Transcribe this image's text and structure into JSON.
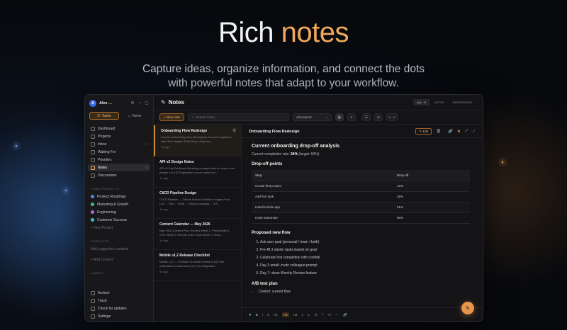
{
  "hero": {
    "title_main": "Rich",
    "title_accent": "notes",
    "subtitle_line1": "Capture ideas, organize information, and connect the dots",
    "subtitle_line2": "with powerful notes that adapt to your workflow."
  },
  "app": {
    "user_name": "Alex ...",
    "user_initial": "A",
    "tabs": [
      {
        "label": "Tasks",
        "active": true
      },
      {
        "label": "Home",
        "active": false
      }
    ],
    "nav": [
      {
        "label": "Dashboard",
        "count": ""
      },
      {
        "label": "Projects",
        "count": ""
      },
      {
        "label": "Inbox",
        "count": ">"
      },
      {
        "label": "Waiting For",
        "count": ""
      },
      {
        "label": "Priorities",
        "count": ""
      },
      {
        "label": "Notes",
        "count": "8",
        "active": true
      },
      {
        "label": "Discussions",
        "count": ""
      }
    ],
    "team_projects_heading": "TEAM PROJECTS",
    "projects": [
      {
        "label": "Product Roadmap",
        "color": "#4b8cf0"
      },
      {
        "label": "Marketing & Growth",
        "color": "#3fbf8a"
      },
      {
        "label": "Engineering",
        "color": "#b06ad8"
      },
      {
        "label": "Customer Success",
        "color": "#3fc0c8"
      }
    ],
    "new_project": "+ New Project",
    "contacts_heading": "CONTACTS",
    "contacts_hint": "Add suggested contacts",
    "add_contact": "+ Add Contact",
    "labels_heading": "LABELS",
    "bottom": [
      {
        "label": "Archive"
      },
      {
        "label": "Trash"
      },
      {
        "label": "Check for updates"
      },
      {
        "label": "Settings"
      }
    ]
  },
  "topbar": {
    "title": "Notes",
    "filters": [
      {
        "label": "ALL · 5",
        "on": true
      },
      {
        "label": "NOTES",
        "on": false
      },
      {
        "label": "REFERENCES",
        "on": false
      }
    ]
  },
  "toolbar": {
    "new_note": "+ New note",
    "search_placeholder": "Search notes...",
    "project_select": "All projects",
    "sort_label": "A→Z"
  },
  "notes": [
    {
      "title": "Onboarding Flow Redesign",
      "preview": "Current onboarding drop-off analysis Current completion rate: 34% (target: 60%) Drop-off points |...",
      "date": "4d ago",
      "active": true
    },
    {
      "title": "API v2 Design Notes",
      "preview": "API v2 Key Decisions Breaking changes task-id moves from integer to ULID Pagination: cursor based ins...",
      "date": "4d ago",
      "active": false
    },
    {
      "title": "CI/CD Pipeline Design",
      "preview": "CI/CD Pipeline — GitHub Actions Workflow stages Push → Lint → Test → Build → Deploy (staging) → E3...",
      "date": "4d ago",
      "active": false
    },
    {
      "title": "Content Calendar — May 2026",
      "preview": "May 2026 Content Plan Themes Week 1: Productivity & GTD Week 2: Remote team focus Week 3: Team...",
      "date": "4d ago",
      "active": false
    },
    {
      "title": "Mobile v1.2 Release Checklist",
      "preview": "Mobile v1.2 — Release Checklist Features [x] Push notification infrastructure [x] FCM integration...",
      "date": "4d ago",
      "active": false
    }
  ],
  "editor": {
    "title": "Onboarding Flow Redesign",
    "edit_label": "Edit",
    "h1": "Current onboarding drop-off analysis",
    "rate_prefix": "Current completion rate: ",
    "rate_value": "34%",
    "rate_suffix": " (target: 60%)",
    "h2_dropoff": "Drop-off points",
    "table_headers": [
      "Step",
      "Drop-off"
    ],
    "table_rows": [
      [
        "Create first project",
        "12%"
      ],
      [
        "Add first task",
        "28%"
      ],
      [
        "Install mobile app",
        "51%"
      ],
      [
        "Invite teammate",
        "66%"
      ]
    ],
    "h2_flow": "Proposed new flow",
    "flow_items": [
      "Ask user goal (personal / team / both)",
      "Pre-fill 3 starter tasks based on goal",
      "Celebrate first completion with confetti",
      "Day 3 email: invite colleague prompt",
      "Day 7: show Weekly Review feature"
    ],
    "h2_ab": "A/B test plan",
    "ab_items": [
      "Control: current flow"
    ]
  },
  "format_bar": [
    "B",
    "I",
    "S",
    "H1",
    "H2",
    "H3",
    "≡",
    "1.",
    "☑",
    "❝",
    "<>",
    "—",
    "🔗"
  ]
}
